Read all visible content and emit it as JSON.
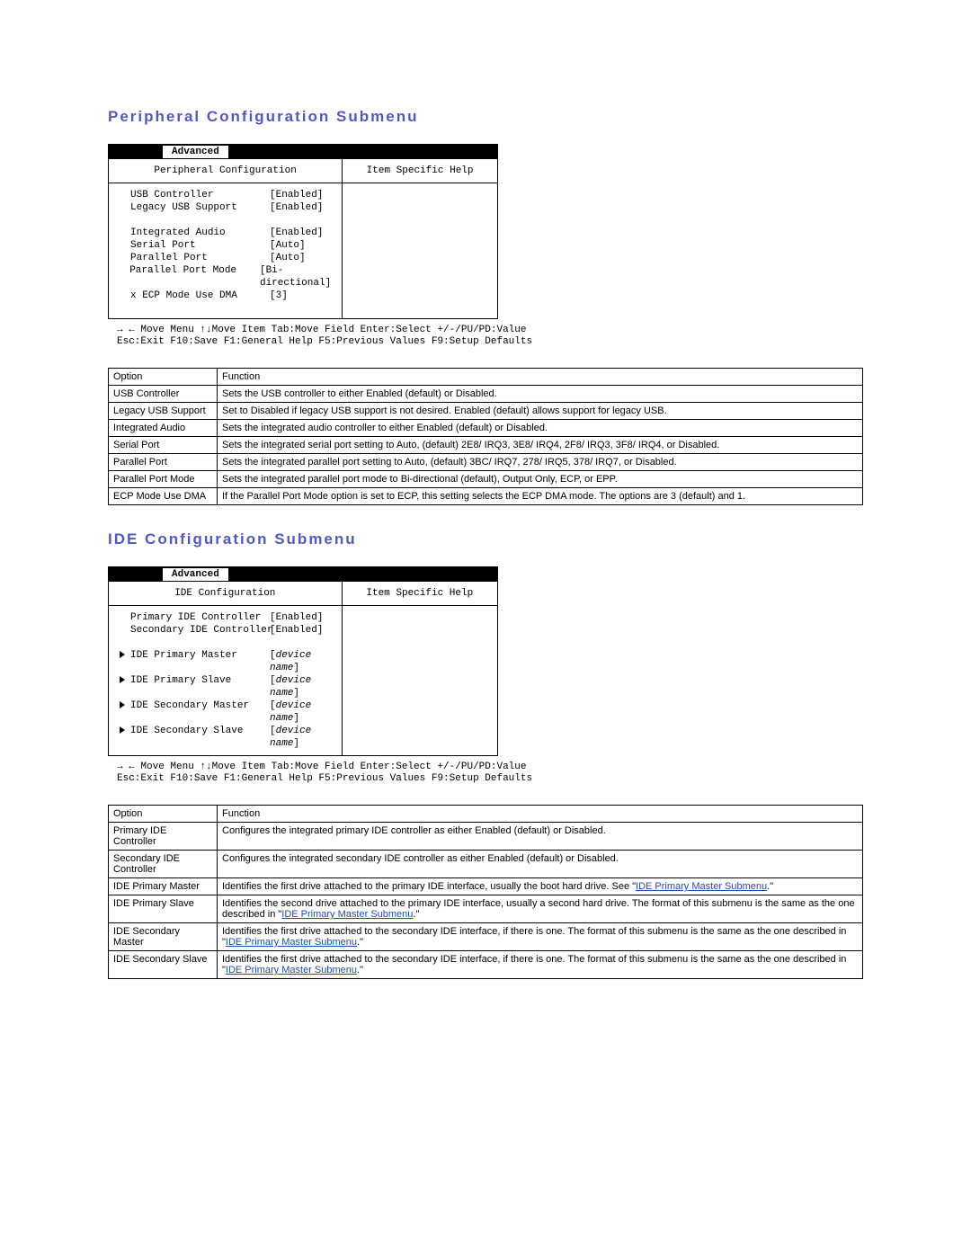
{
  "sections": {
    "peripheral": {
      "heading": "Peripheral Configuration Submenu",
      "bios": {
        "active_tab": "Advanced",
        "title_left": "Peripheral Configuration",
        "title_right": "Item Specific Help",
        "rows": [
          {
            "k": "USB Controller",
            "v": "[Enabled]"
          },
          {
            "k": "Legacy USB Support",
            "v": "[Enabled]"
          },
          {
            "spacer": true
          },
          {
            "k": "Integrated Audio",
            "v": "[Enabled]"
          },
          {
            "k": "Serial Port",
            "v": "[Auto]"
          },
          {
            "k": "Parallel Port",
            "v": "[Auto]"
          },
          {
            "k": "Parallel Port Mode",
            "v": "[Bi-directional]"
          },
          {
            "k": "x ECP Mode Use DMA",
            "v": "[3]"
          }
        ]
      },
      "footer": {
        "l1": "→ ← Move Menu   ↑↓Move Item   Tab:Move Field   Enter:Select   +/-/PU/PD:Value",
        "l2": "Esc:Exit       F10:Save   F1:General Help   F5:Previous Values  F9:Setup Defaults"
      },
      "table": {
        "h1": "Option",
        "h2": "Function",
        "rows": [
          {
            "o": "USB Controller",
            "f": [
              {
                "t": "Sets the USB controller to either Enabled (default) or Disabled."
              }
            ]
          },
          {
            "o": "Legacy USB Support",
            "f": [
              {
                "t": "Set to Disabled if legacy USB support is not desired. Enabled (default) allows support for legacy USB."
              }
            ]
          },
          {
            "o": "Integrated Audio",
            "f": [
              {
                "t": "Sets the integrated audio controller to either Enabled (default) or Disabled."
              }
            ]
          },
          {
            "o": "Serial Port",
            "f": [
              {
                "t": "Sets the integrated serial port setting to Auto, (default) 2E8/ IRQ3, 3E8/ IRQ4, 2F8/ IRQ3, 3F8/ IRQ4, or Disabled."
              }
            ]
          },
          {
            "o": "Parallel Port",
            "f": [
              {
                "t": "Sets the integrated parallel port setting to Auto, (default) 3BC/ IRQ7, 278/ IRQ5, 378/ IRQ7, or Disabled."
              }
            ]
          },
          {
            "o": "Parallel Port Mode",
            "f": [
              {
                "t": "Sets the integrated parallel port mode to Bi-directional (default), Output Only, ECP, or EPP."
              }
            ]
          },
          {
            "o": "ECP Mode Use DMA",
            "f": [
              {
                "t": "If the Parallel Port Mode option is set to ECP, this setting selects the ECP DMA mode. The options are 3 (default) and 1."
              }
            ]
          }
        ]
      }
    },
    "ide": {
      "heading": "IDE Configuration Submenu",
      "bios": {
        "active_tab": "Advanced",
        "title_left": "IDE Configuration",
        "title_right": "Item Specific Help",
        "rows": [
          {
            "k": "Primary IDE Controller",
            "v": "[Enabled]"
          },
          {
            "k": "Secondary IDE Controller",
            "v": "[Enabled]"
          },
          {
            "spacer": true
          },
          {
            "arrow": true,
            "k": "IDE Primary Master",
            "v": "[device name]",
            "italic": true
          },
          {
            "arrow": true,
            "k": "IDE Primary Slave",
            "v": "[device name]",
            "italic": true
          },
          {
            "arrow": true,
            "k": "IDE Secondary Master",
            "v": "[device name]",
            "italic": true
          },
          {
            "arrow": true,
            "k": "IDE Secondary Slave",
            "v": "[device name]",
            "italic": true
          }
        ]
      },
      "footer": {
        "l1": "→ ← Move Menu   ↑↓Move Item   Tab:Move Field   Enter:Select   +/-/PU/PD:Value",
        "l2": "Esc:Exit       F10:Save   F1:General Help   F5:Previous Values  F9:Setup Defaults"
      },
      "table": {
        "h1": "Option",
        "h2": "Function",
        "rows": [
          {
            "o": "Primary IDE Controller",
            "f": [
              {
                "t": "Configures the integrated primary IDE controller as either Enabled (default) or Disabled."
              }
            ]
          },
          {
            "o": "Secondary IDE Controller",
            "f": [
              {
                "t": "Configures the integrated secondary IDE controller as either Enabled (default) or Disabled."
              }
            ]
          },
          {
            "o": "IDE Primary Master",
            "f": [
              {
                "t": "Identifies the first drive attached to the primary IDE interface, usually the boot hard drive. See \""
              },
              {
                "link": true,
                "t": "IDE Primary Master Submenu"
              },
              {
                "t": ".\""
              }
            ]
          },
          {
            "o": "IDE Primary Slave",
            "f": [
              {
                "t": "Identifies the second drive attached to the primary IDE interface, usually a second hard drive. The format of this submenu is the same as the one described in \""
              },
              {
                "link": true,
                "t": "IDE Primary Master Submenu"
              },
              {
                "t": ".\""
              }
            ]
          },
          {
            "o": "IDE Secondary Master",
            "f": [
              {
                "t": "Identifies the first drive attached to the secondary IDE interface, if there is one. The format of this submenu is the same as the one described in \""
              },
              {
                "link": true,
                "t": "IDE Primary Master Submenu"
              },
              {
                "t": ".\""
              }
            ]
          },
          {
            "o": "IDE Secondary Slave",
            "f": [
              {
                "t": "Identifies the first drive attached to the secondary IDE interface, if there is one. The format of this submenu is the same as the one described in \""
              },
              {
                "link": true,
                "t": "IDE Primary Master Submenu"
              },
              {
                "t": ".\""
              }
            ]
          }
        ]
      }
    }
  }
}
